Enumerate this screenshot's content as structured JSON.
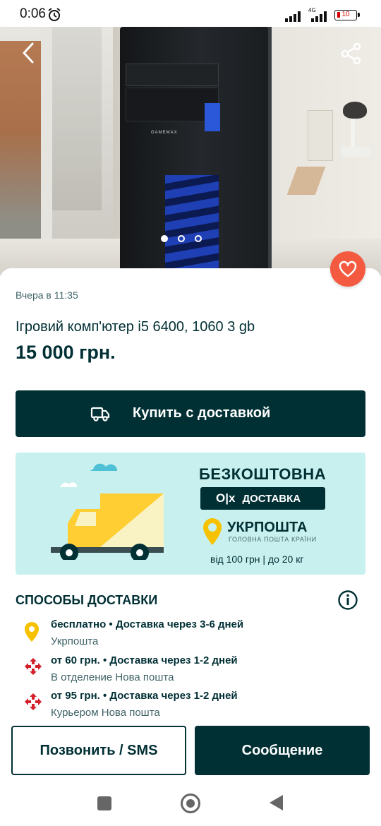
{
  "status_bar": {
    "time": "0:06",
    "network": "4G",
    "battery": "10"
  },
  "gallery": {
    "image_count": 3,
    "active_index": 0,
    "case_logo": "GAMEMAX"
  },
  "listing": {
    "posted": "Вчера в 11:35",
    "title": "Ігровий комп'ютер і5 6400, 1060 3 gb",
    "price": "15 000 грн."
  },
  "buy_button": {
    "label": "Купить с доставкой"
  },
  "promo_banner": {
    "headline": "БЕЗКОШТОВНА",
    "brand": "O|x",
    "delivery": "ДОСТАВКА",
    "carrier": "УКРПОШТА",
    "carrier_tagline": "ГОЛОВНА ПОШТА КРАЇНИ",
    "terms": "від 100 грн | до 20 кг"
  },
  "delivery": {
    "title": "СПОСОБЫ ДОСТАВКИ",
    "methods": [
      {
        "main": "бесплатно • Доставка через 3-6 дней",
        "sub": "Укрпошта",
        "icon": "ukrposhta-pin-icon"
      },
      {
        "main": "от 60 грн. • Доставка через 1-2 дней",
        "sub": "В отделение Нова пошта",
        "icon": "nova-poshta-icon"
      },
      {
        "main": "от 95 грн. • Доставка через 1-2 дней",
        "sub": "Курьером Нова пошта",
        "icon": "nova-poshta-icon"
      }
    ]
  },
  "actions": {
    "call": "Позвонить / SMS",
    "message": "Сообщение"
  },
  "colors": {
    "primary": "#002f34",
    "accent": "#f35a3f",
    "banner_bg": "#c8f0ee",
    "ukrposhta": "#f6c200",
    "nova_poshta": "#d4202b"
  }
}
